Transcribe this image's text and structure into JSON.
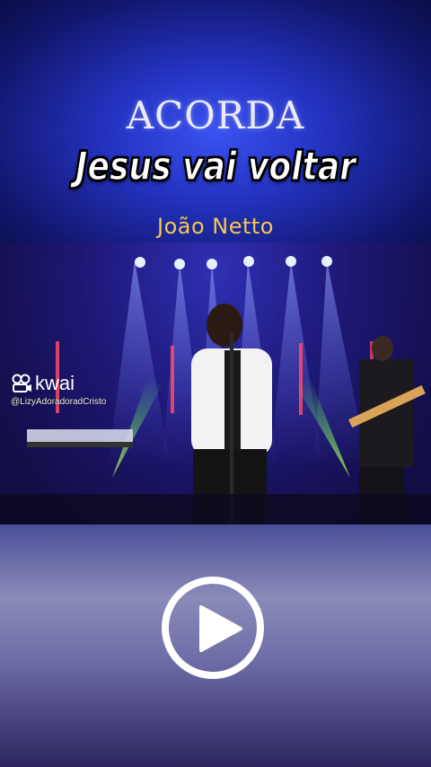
{
  "banner": {
    "title": "ACORDA",
    "subtitle": "Jesus vai voltar",
    "artist": "João Netto"
  },
  "watermark": {
    "brand": "kwai",
    "brand_icon": "kwai-logo-icon",
    "username": "@LizyAdoradoradCristo"
  },
  "player": {
    "control_icon": "play-icon",
    "state": "paused"
  },
  "colors": {
    "artist_text": "#f4c74d",
    "title_text": "#e9ecff",
    "banner_blue": "#2d3fd6"
  }
}
